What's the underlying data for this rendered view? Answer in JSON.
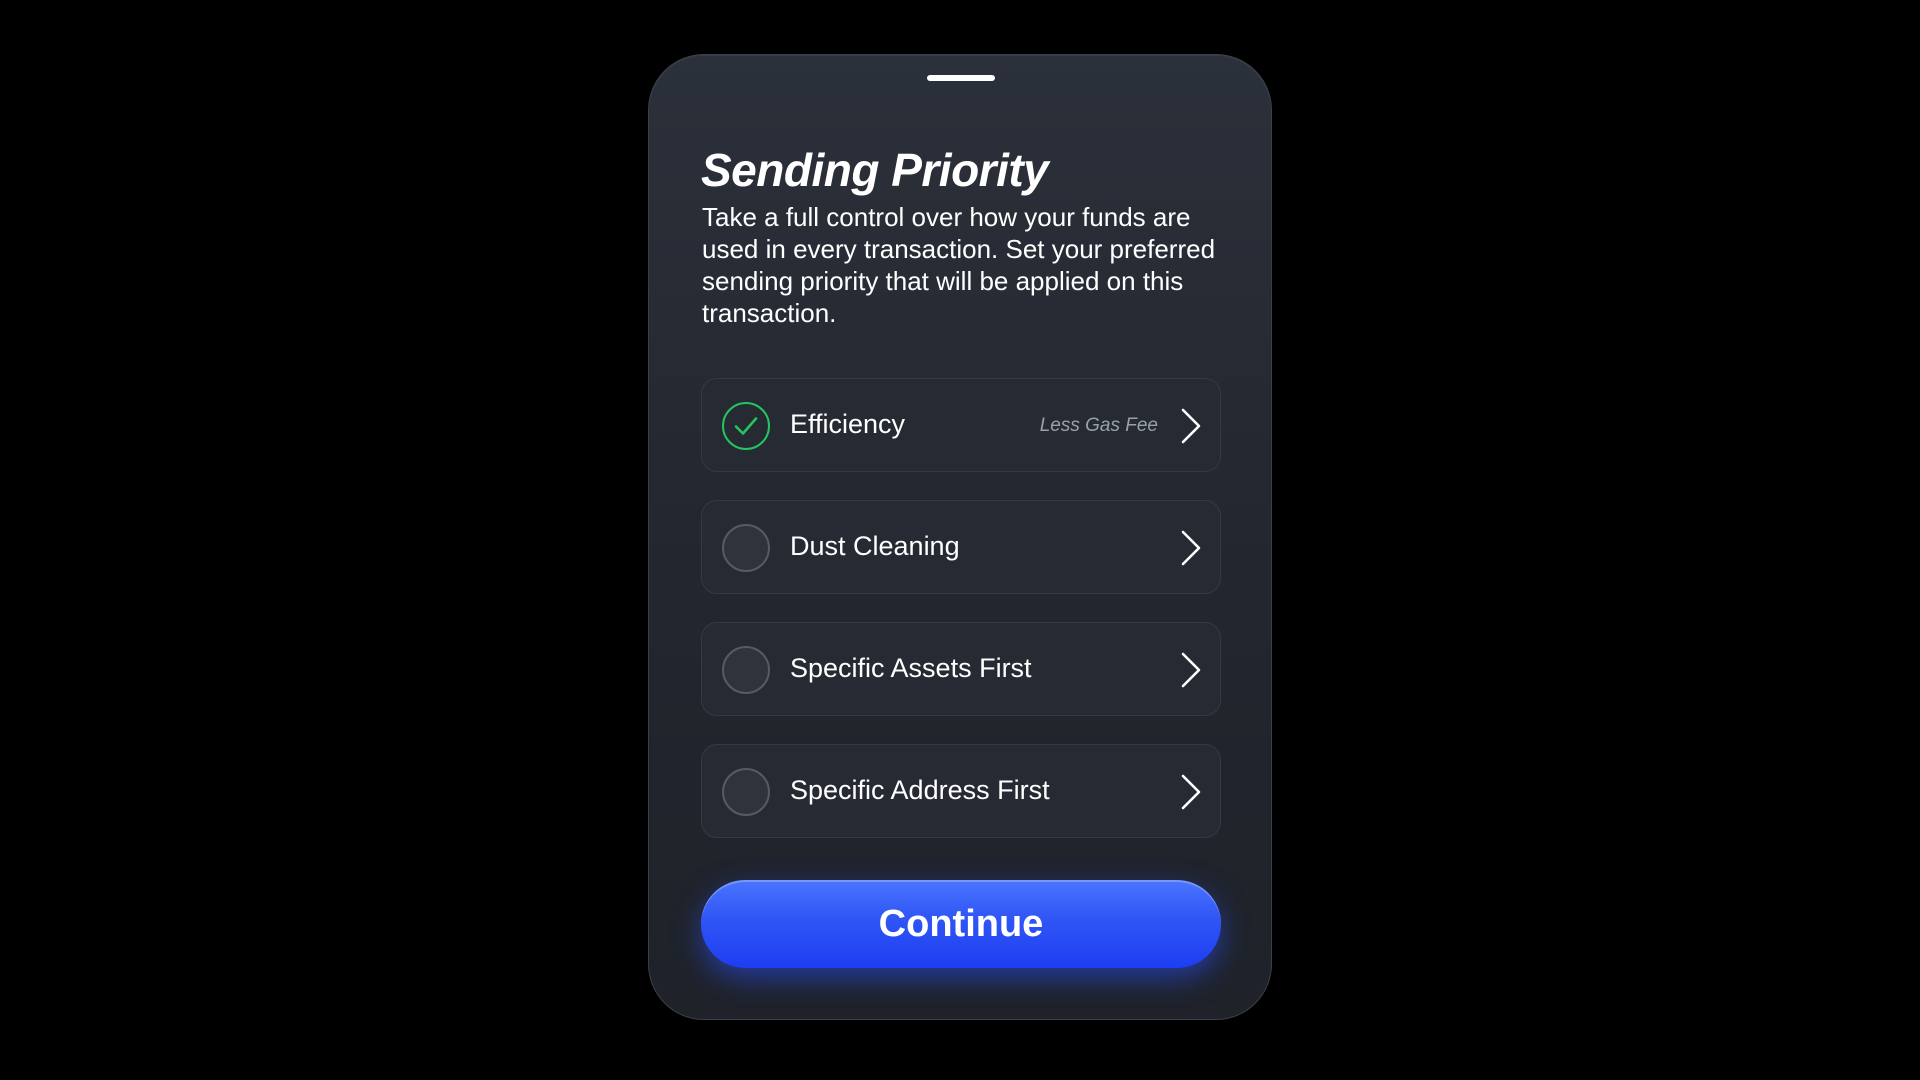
{
  "sheet": {
    "title": "Sending Priority",
    "description": "Take a full control over how your funds are used in every transaction. Set your preferred sending priority that will be applied on this transaction."
  },
  "options": [
    {
      "label": "Efficiency",
      "hint": "Less Gas Fee",
      "selected": true
    },
    {
      "label": "Dust Cleaning",
      "hint": "",
      "selected": false
    },
    {
      "label": "Specific Assets First",
      "hint": "",
      "selected": false
    },
    {
      "label": "Specific Address First",
      "hint": "",
      "selected": false
    }
  ],
  "continue_button": {
    "label": "Continue"
  },
  "icons": {
    "selected": "checkmark-icon",
    "row_action": "chevron-right-icon"
  },
  "colors": {
    "accent": "#2f55f5",
    "selected_check": "#22c55e",
    "card_background": "#262a33",
    "sheet_background": "#22262e"
  }
}
